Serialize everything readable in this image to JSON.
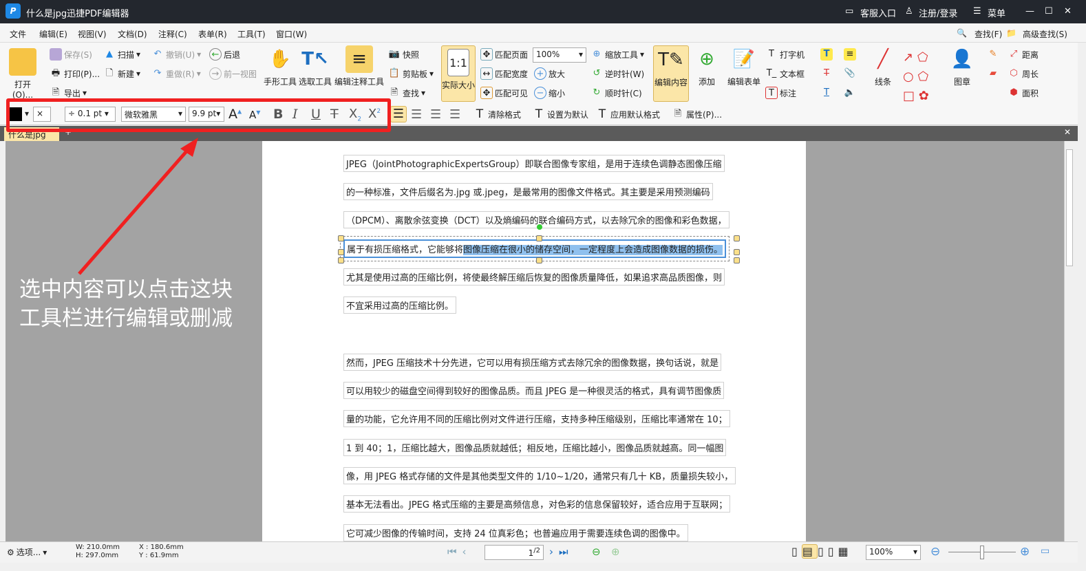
{
  "title": "什么是jpg迅捷PDF编辑器",
  "titlebar": {
    "service": "客服入口",
    "login": "注册/登录",
    "menu": "菜单"
  },
  "menu": [
    "文件",
    "编辑(E)",
    "视图(V)",
    "文档(D)",
    "注释(C)",
    "表单(R)",
    "工具(T)",
    "窗口(W)"
  ],
  "menu_right": {
    "find": "查找(F)",
    "adv_find": "高级查找(S)"
  },
  "ribbon": {
    "open": "打开(O)...",
    "save": "保存(S)",
    "print": "打印(P)...",
    "export": "导出",
    "scan": "扫描",
    "new": "新建",
    "undo": "撤销(U)",
    "redo": "重做(R)",
    "back": "后退",
    "prev_view": "前一视图",
    "hand": "手形工具",
    "select": "选取工具",
    "edit_annot": "编辑注释工具",
    "snapshot": "快照",
    "clipboard": "剪贴板",
    "find": "查找",
    "actual": "实际大小",
    "fit_page": "匹配页面",
    "fit_width": "匹配宽度",
    "fit_visible": "匹配可见",
    "zoom_value": "100%",
    "zoom_in": "放大",
    "zoom_out": "缩小",
    "zoom_tool": "缩放工具",
    "ccw": "逆时针(W)",
    "cw": "顺时针(C)",
    "edit_content": "编辑内容",
    "add": "添加",
    "edit_form": "编辑表单",
    "typewriter": "打字机",
    "textbox": "文本框",
    "callout": "标注",
    "lines": "线条",
    "stamp": "图章",
    "distance": "距离",
    "perimeter": "周长",
    "area": "面积"
  },
  "format": {
    "line_width": "0.1 pt",
    "font": "微软雅黑",
    "font_size": "9.9 pt",
    "clear": "清除格式",
    "set_default": "设置为默认",
    "apply_default": "应用默认格式",
    "properties": "属性(P)...",
    "fill_color": "#000000"
  },
  "tab": "什么是jpg",
  "lines": [
    "JPEG（JointPhotographicExpertsGroup）即联合图像专家组，是用于连续色调静态图像压缩",
    "的一种标准，文件后缀名为.jpg 或.jpeg，是最常用的图像文件格式。其主要是采用预测编码",
    "（DPCM）、离散余弦变换（DCT）以及熵编码的联合编码方式，以去除冗余的图像和彩色数据，",
    "属于有损压缩格式，它能够将",
    "尤其是使用过高的压缩比例，将使最终解压缩后恢复的图像质量降低，如果追求高品质图像，则",
    "不宜采用过高的压缩比例。",
    "然而，JPEG 压缩技术十分先进，它可以用有损压缩方式去除冗余的图像数据，换句话说，就是",
    "可以用较少的磁盘空间得到较好的图像品质。而且 JPEG 是一种很灵活的格式，具有调节图像质",
    "量的功能，它允许用不同的压缩比例对文件进行压缩，支持多种压缩级别，压缩比率通常在 10；",
    "1 到 40；1，压缩比越大，图像品质就越低；相反地，压缩比越小，图像品质就越高。同一幅图",
    "像，用 JPEG 格式存储的文件是其他类型文件的 1/10~1/20，通常只有几十 KB，质量损失较小，",
    "基本无法看出。JPEG 格式压缩的主要是高频信息，对色彩的信息保留较好，适合应用于互联网；",
    "它可减少图像的传输时间，支持 24 位真彩色；也普遍应用于需要连续色调的图像中。"
  ],
  "selected_text": "图像压缩在很小的储存空间，一定程度上会造成图像数据的损伤。",
  "annotation": {
    "line1": "选中内容可以点击这块",
    "line2": "工具栏进行编辑或删减",
    "color": "#f02020"
  },
  "status": {
    "options": "选项...",
    "w": "W: 210.0mm",
    "h": "H: 297.0mm",
    "x": "X : 180.6mm",
    "y": "Y :   61.9mm",
    "page": "1",
    "pages": "/2",
    "zoom": "100%"
  }
}
